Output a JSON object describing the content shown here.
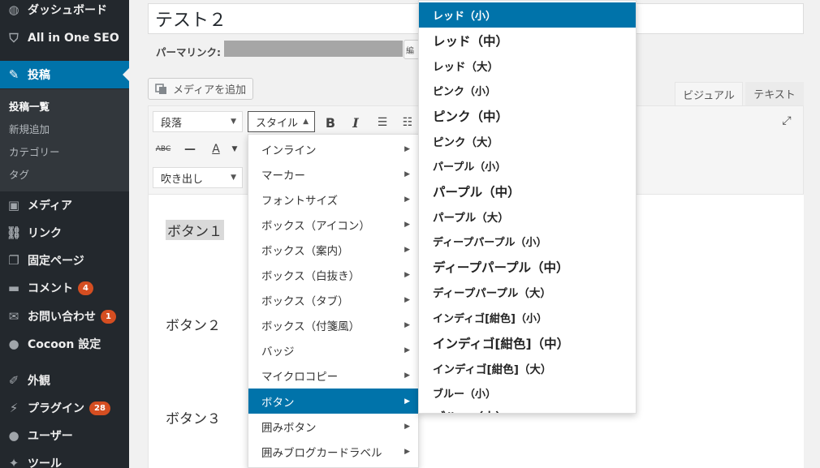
{
  "sidebar": {
    "items": [
      {
        "icon": "dashboard-icon",
        "glyph": "◍",
        "label": "ダッシュボード"
      },
      {
        "icon": "shield-icon",
        "glyph": "⛉",
        "label": "All in One SEO"
      },
      {
        "icon": "pin-icon",
        "glyph": "✎",
        "label": "投稿"
      },
      {
        "icon": "media-icon",
        "glyph": "▣",
        "label": "メディア"
      },
      {
        "icon": "link-icon",
        "glyph": "⛓",
        "label": "リンク"
      },
      {
        "icon": "page-icon",
        "glyph": "❐",
        "label": "固定ページ"
      },
      {
        "icon": "comment-icon",
        "glyph": "▬",
        "label": "コメント",
        "count": "4"
      },
      {
        "icon": "mail-icon",
        "glyph": "✉",
        "label": "お問い合わせ",
        "count": "1"
      },
      {
        "icon": "circle-icon",
        "glyph": "●",
        "label": "Cocoon 設定"
      },
      {
        "icon": "appearance-icon",
        "glyph": "✐",
        "label": "外観"
      },
      {
        "icon": "plugin-icon",
        "glyph": "⚡",
        "label": "プラグイン",
        "count": "28"
      },
      {
        "icon": "user-icon",
        "glyph": "●",
        "label": "ユーザー"
      },
      {
        "icon": "tool-icon",
        "glyph": "✦",
        "label": "ツール"
      }
    ],
    "submenu": [
      "投稿一覧",
      "新規追加",
      "カテゴリー",
      "タグ"
    ]
  },
  "editor": {
    "title": "テスト２",
    "permalink_label": "パーマリンク:",
    "permalink_edit": "編",
    "add_media": "メディアを追加",
    "tab_visual": "ビジュアル",
    "tab_text": "テキスト",
    "format_select": "段落",
    "style_select": "スタイル",
    "balloon_select": "吹き出し",
    "content_lines": [
      "ボタン１",
      "ボタン２",
      "ボタン３"
    ]
  },
  "style_menu": {
    "items": [
      "インライン",
      "マーカー",
      "フォントサイズ",
      "ボックス（アイコン）",
      "ボックス（案内）",
      "ボックス（白抜き）",
      "ボックス（タブ）",
      "ボックス（付箋風）",
      "バッジ",
      "マイクロコピー",
      "ボタン",
      "囲みボタン",
      "囲みブログカードラベル"
    ],
    "selected": "ボタン"
  },
  "button_submenu": {
    "items": [
      "レッド（小）",
      "レッド（中）",
      "レッド（大）",
      "ピンク（小）",
      "ピンク（中）",
      "ピンク（大）",
      "パープル（小）",
      "パープル（中）",
      "パープル（大）",
      "ディープパープル（小）",
      "ディープパープル（中）",
      "ディープパープル（大）",
      "インディゴ[紺色]（小）",
      "インディゴ[紺色]（中）",
      "インディゴ[紺色]（大）",
      "ブルー（小）",
      "ブルー（中）"
    ],
    "selected": "レッド（小）"
  },
  "colors": {
    "sidebar_bg": "#23282d",
    "accent": "#0073aa",
    "badge": "#d54e21"
  }
}
